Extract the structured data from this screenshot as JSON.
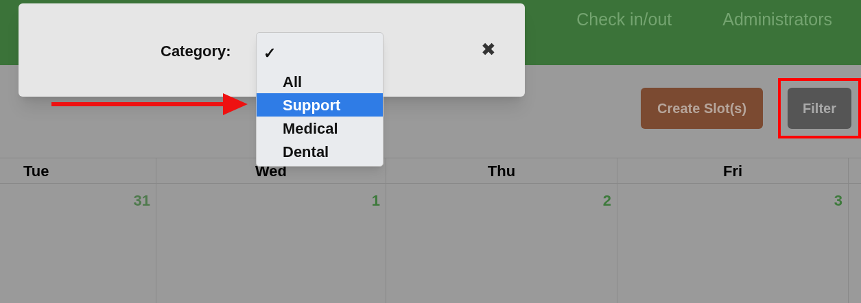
{
  "nav": [
    {
      "label": "Check in/out"
    },
    {
      "label": "Administrators"
    }
  ],
  "buttons": [
    {
      "label": "Create Slot(s)",
      "kind": "primary",
      "highlighted": false
    },
    {
      "label": "Filter",
      "kind": "secondary",
      "highlighted": true
    }
  ],
  "calendar": {
    "columns": [
      "Tue",
      "Wed",
      "Thu",
      "Fri"
    ],
    "days": [
      {
        "label": "31",
        "outside_month": true
      },
      {
        "label": "1",
        "outside_month": false
      },
      {
        "label": "2",
        "outside_month": false
      },
      {
        "label": "3",
        "outside_month": false
      }
    ]
  },
  "modal": {
    "label": "Category:",
    "close": "✖",
    "check_glyph": "✓",
    "options": [
      {
        "kind": "blank",
        "checked": true,
        "selected": false
      },
      {
        "kind": "option",
        "label": "All",
        "checked": false,
        "selected": false
      },
      {
        "kind": "option",
        "label": "Support",
        "checked": false,
        "selected": true
      },
      {
        "kind": "option",
        "label": "Medical",
        "checked": false,
        "selected": false
      },
      {
        "kind": "option",
        "label": "Dental",
        "checked": false,
        "selected": false
      }
    ]
  }
}
